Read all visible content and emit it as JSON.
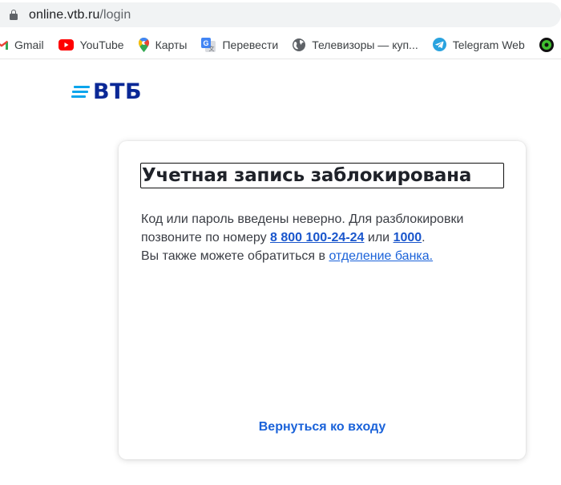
{
  "browser": {
    "url_host": "online.vtb.ru",
    "url_path": "/login",
    "bookmarks": [
      {
        "label": "Gmail",
        "icon": "gmail-icon"
      },
      {
        "label": "YouTube",
        "icon": "youtube-icon"
      },
      {
        "label": "Карты",
        "icon": "maps-icon"
      },
      {
        "label": "Перевести",
        "icon": "translate-icon"
      },
      {
        "label": "Телевизоры — куп...",
        "icon": "globe-icon"
      },
      {
        "label": "Telegram Web",
        "icon": "telegram-icon"
      }
    ]
  },
  "page": {
    "logo_text": "ВТБ",
    "card": {
      "title": "Учетная запись заблокирована",
      "text_part1": "Код или пароль введены неверно. Для разблокировки позвоните по номеру ",
      "phone_main": "8 800 100-24-24",
      "text_or": " или ",
      "phone_short": "1000",
      "text_dot": ".",
      "text_part2": "Вы также можете обратиться в ",
      "branch_link": "отделение банка.",
      "back_link": "Вернуться ко входу"
    }
  },
  "colors": {
    "brand_dark": "#0a2896",
    "brand_light": "#0ba5ec",
    "link": "#1a62d9"
  }
}
